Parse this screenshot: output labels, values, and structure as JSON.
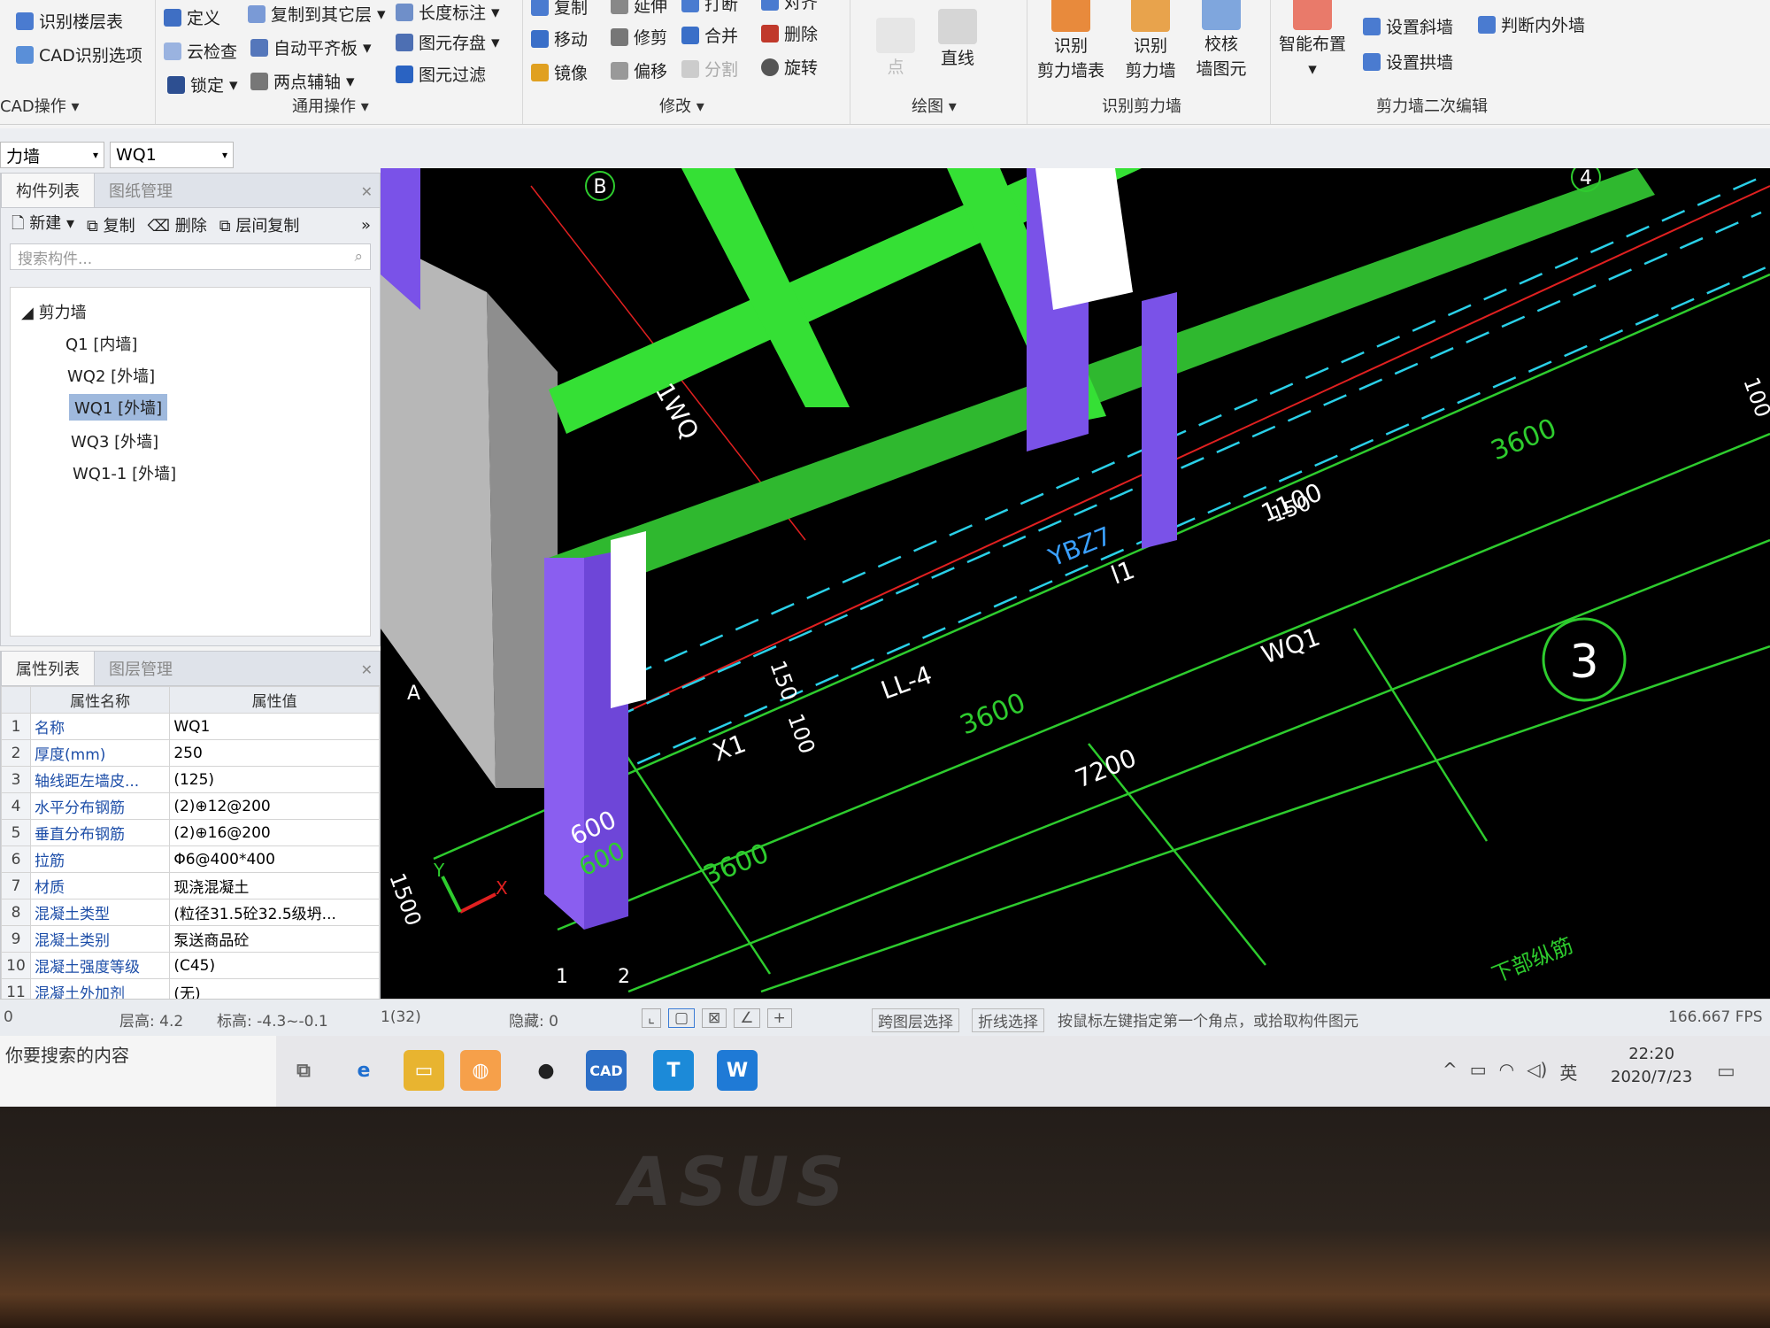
{
  "ribbon": {
    "g1": {
      "items": [
        "识别楼层表",
        "CAD识别选项"
      ],
      "label": "CAD操作"
    },
    "g2": {
      "items": [
        "定义",
        "复制到其它层",
        "长度标注",
        "云检查",
        "自动平齐板",
        "图元存盘",
        "锁定",
        "两点辅轴",
        "图元过滤"
      ],
      "label": "通用操作"
    },
    "g3": {
      "items": [
        "复制",
        "延伸",
        "打断",
        "对齐",
        "移动",
        "修剪",
        "合并",
        "删除",
        "镜像",
        "偏移",
        "分割",
        "旋转"
      ],
      "label": "修改"
    },
    "g4": {
      "items": [
        "点",
        "直线"
      ],
      "label": "绘图"
    },
    "g5": {
      "items": [
        "识别剪力墙表",
        "识别剪力墙",
        "校核墙图元"
      ],
      "label": "识别剪力墙"
    },
    "g6": {
      "items": [
        "智能布置",
        "设置斜墙",
        "判断内外墙",
        "设置拱墙"
      ],
      "label": "剪力墙二次编辑"
    }
  },
  "toolbar": {
    "type_select": "力墙",
    "name_select": "WQ1"
  },
  "component_panel": {
    "tabs": [
      "构件列表",
      "图纸管理"
    ],
    "actions": [
      "新建",
      "复制",
      "删除",
      "层间复制"
    ],
    "search_placeholder": "搜索构件...",
    "root": "剪力墙",
    "items": [
      "Q1 [内墙]",
      "WQ2 [外墙]",
      "WQ1 [外墙]",
      "WQ3 [外墙]",
      "WQ1-1 [外墙]"
    ],
    "selected_index": 2
  },
  "property_panel": {
    "tabs": [
      "属性列表",
      "图层管理"
    ],
    "headers": [
      "属性名称",
      "属性值"
    ],
    "rows": [
      {
        "no": "1",
        "name": "名称",
        "value": "WQ1"
      },
      {
        "no": "2",
        "name": "厚度(mm)",
        "value": "250"
      },
      {
        "no": "3",
        "name": "轴线距左墙皮...",
        "value": "(125)"
      },
      {
        "no": "4",
        "name": "水平分布钢筋",
        "value": "(2)⊕12@200"
      },
      {
        "no": "5",
        "name": "垂直分布钢筋",
        "value": "(2)⊕16@200"
      },
      {
        "no": "6",
        "name": "拉筋",
        "value": "Φ6@400*400"
      },
      {
        "no": "7",
        "name": "材质",
        "value": "现浇混凝土"
      },
      {
        "no": "8",
        "name": "混凝土类型",
        "value": "(粒径31.5砼32.5级坍..."
      },
      {
        "no": "9",
        "name": "混凝土类别",
        "value": "泵送商品砼"
      },
      {
        "no": "10",
        "name": "混凝土强度等级",
        "value": "(C45)"
      },
      {
        "no": "11",
        "name": "混凝土外加剂",
        "value": "(无)"
      }
    ]
  },
  "cad": {
    "axis_B": "B",
    "axis_4": "4",
    "axis_3": "3",
    "axis_1": "1",
    "axis_2": "2",
    "axis_A": "A",
    "dim_1100": "1100",
    "dim_3600_a": "3600",
    "dim_3600_b": "3600",
    "dim_3600_c": "3600",
    "dim_7200": "7200",
    "dim_600": "600",
    "dim_600b": "600",
    "dim_150": "150",
    "dim_100": "100",
    "dim_150b": "150",
    "dim_100b": "100",
    "dim_1500": "1500",
    "lbl_ll4": "LL-4",
    "lbl_wq1": "WQ1",
    "lbl_ybz": "YBZ7",
    "lbl_lwq1": "1WQ",
    "lbl_xy": "X",
    "lbl_bottom": "下部纵筋",
    "l1": "l1",
    "x1": "X1",
    "ysym": "Y",
    "xsym": "X"
  },
  "status": {
    "floor_height": "层高: 4.2",
    "elevation": "标高: -4.3~-0.1",
    "count": "1(32)",
    "hidden": "隐藏: 0",
    "cross_layer": "跨图层选择",
    "polyline": "折线选择",
    "hint": "按鼠标左键指定第一个角点，或拾取构件图元",
    "fps": "166.667 FPS",
    "left0": "0"
  },
  "taskbar": {
    "search": "你要搜索的内容",
    "time": "22:20",
    "date": "2020/7/23",
    "ime": "英",
    "cad_label": "CAD"
  },
  "brand": "ASUS"
}
